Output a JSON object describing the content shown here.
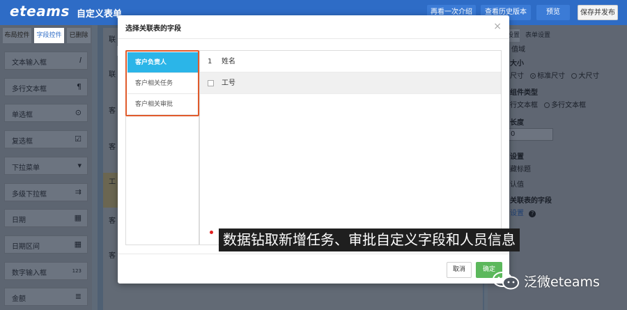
{
  "topbar": {
    "logo": "eteams",
    "title": "自定义表单",
    "buttons": [
      {
        "label": "再看一次介绍"
      },
      {
        "label": "查看历史版本"
      },
      {
        "label": "预览"
      },
      {
        "label": "保存并发布"
      }
    ]
  },
  "left_panel": {
    "tabs": [
      {
        "label": "布局控件"
      },
      {
        "label": "字段控件"
      },
      {
        "label": "已删除"
      }
    ],
    "controls": [
      {
        "label": "文本输入框",
        "icon": "text-input-icon",
        "glyph": "𝐼"
      },
      {
        "label": "多行文本框",
        "icon": "paragraph-icon",
        "glyph": "¶"
      },
      {
        "label": "单选框",
        "icon": "radio-icon",
        "glyph": "⊙"
      },
      {
        "label": "复选框",
        "icon": "checkbox-icon",
        "glyph": "☑"
      },
      {
        "label": "下拉菜单",
        "icon": "caret-down-icon",
        "glyph": "▾"
      },
      {
        "label": "多级下拉框",
        "icon": "multi-select-icon",
        "glyph": "⇉"
      },
      {
        "label": "日期",
        "icon": "calendar-icon",
        "glyph": "▦"
      },
      {
        "label": "日期区间",
        "icon": "calendar-range-icon",
        "glyph": "▦"
      },
      {
        "label": "数字输入框",
        "icon": "number-icon",
        "glyph": "123"
      },
      {
        "label": "金额",
        "icon": "coins-icon",
        "glyph": "≣"
      }
    ]
  },
  "canvas": {
    "labels": [
      "联",
      "联",
      "客",
      "客",
      "工",
      "客",
      "客"
    ]
  },
  "right_panel": {
    "tabs": [
      {
        "label": "设置"
      },
      {
        "label": "表单设置"
      }
    ],
    "value_hint": "值域",
    "size_title": "大小",
    "size_options": [
      {
        "label": "尺寸"
      },
      {
        "label": "标准尺寸"
      },
      {
        "label": "大尺寸"
      }
    ],
    "type_title": "组件类型",
    "type_options": [
      {
        "label": "行文本框"
      },
      {
        "label": "多行文本框"
      }
    ],
    "length_title": "长度",
    "length_value": "0",
    "settings_title": "设置",
    "hide_title": "藏标题",
    "default_value": "认值",
    "related_title": "关联表的字段",
    "related_link": "设置",
    "help_icon": "?"
  },
  "modal": {
    "title": "选择关联表的字段",
    "close": "×",
    "tabs": [
      {
        "label": "客户负责人",
        "active": true
      },
      {
        "label": "客户相关任务",
        "active": false
      },
      {
        "label": "客户相关审批",
        "active": false
      }
    ],
    "fields": [
      {
        "marker": "1",
        "name": "姓名",
        "checked": true
      },
      {
        "marker": "",
        "name": "工号",
        "checked": false
      }
    ],
    "cancel_label": "取消",
    "ok_label": "确定"
  },
  "caption": "数据钻取新增任务、审批自定义字段和人员信息",
  "watermark": "泛微eteams",
  "colors": {
    "brand_blue": "#2e6cc6",
    "tab_active": "#2bb5e8",
    "highlight_outline": "#e05a2b",
    "confirm_green": "#5cb85c"
  }
}
